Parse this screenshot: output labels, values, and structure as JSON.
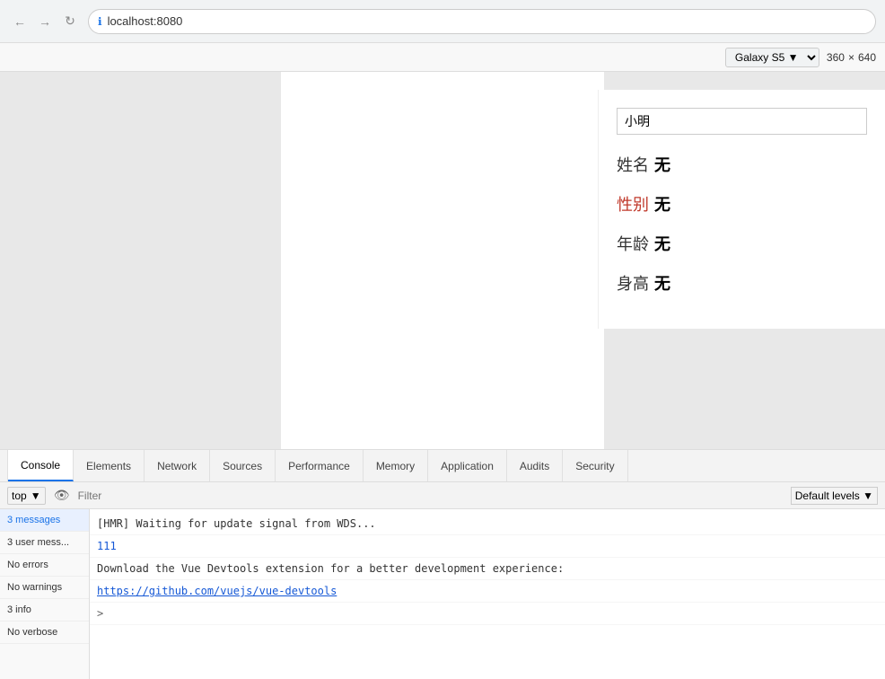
{
  "browser": {
    "url": "localhost:8080",
    "secure_icon": "🔒"
  },
  "responsive": {
    "device": "Galaxy S5 ▼",
    "width": "360",
    "x": "×",
    "height": "640"
  },
  "devtools_tabs_top": [
    {
      "label": "",
      "active": false
    },
    {
      "label": "Console",
      "active": true
    },
    {
      "label": "Elements",
      "active": false
    },
    {
      "label": "Network",
      "active": false
    },
    {
      "label": "Sources",
      "active": false
    },
    {
      "label": "Performance",
      "active": false
    },
    {
      "label": "Memory",
      "active": false
    },
    {
      "label": "Application",
      "active": false
    },
    {
      "label": "Audits",
      "active": false
    },
    {
      "label": "Security",
      "active": false
    }
  ],
  "vue_app": {
    "input_value": "小明",
    "fields": [
      {
        "label": "姓名",
        "label_color": "normal",
        "value": "无"
      },
      {
        "label": "性别",
        "label_color": "red",
        "value": "无"
      },
      {
        "label": "年龄",
        "label_color": "normal",
        "value": "无"
      },
      {
        "label": "身高",
        "label_color": "normal",
        "value": "无"
      }
    ]
  },
  "console": {
    "context": "top",
    "filter_placeholder": "Filter",
    "levels": "Default levels ▼",
    "sidebar_items": [
      {
        "label": "3 messages",
        "active": true
      },
      {
        "label": "3 user mess..."
      },
      {
        "label": "No errors"
      },
      {
        "label": "No warnings"
      },
      {
        "label": "3 info"
      },
      {
        "label": "No verbose"
      }
    ],
    "messages": [
      {
        "text": "[HMR] Waiting for update signal from WDS...",
        "type": "normal"
      },
      {
        "text": "111",
        "type": "blue"
      },
      {
        "text": "Download the Vue Devtools extension for a better development experience:",
        "type": "normal"
      },
      {
        "text": "https://github.com/vuejs/vue-devtools",
        "type": "link",
        "href": "https://github.com/vuejs/vue-devtools"
      },
      {
        "text": ">",
        "type": "arrow"
      }
    ]
  }
}
